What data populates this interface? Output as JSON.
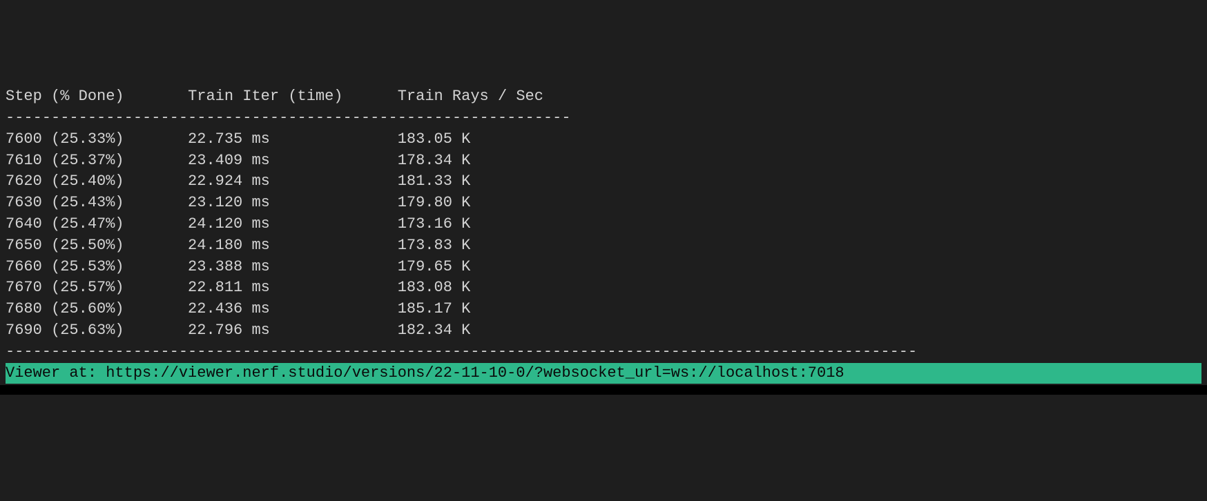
{
  "colors": {
    "background": "#1e1e1e",
    "foreground": "#d4d4d4",
    "highlight_bg": "#2eb88a",
    "highlight_fg": "#0a0a0a"
  },
  "headers": {
    "col1": "Step (% Done)",
    "col2": "Train Iter (time)",
    "col3": "Train Rays / Sec"
  },
  "divider_short": "--------------------------------------------------------------",
  "divider_long": "----------------------------------------------------------------------------------------------------",
  "rows": [
    {
      "step": "7600",
      "pct": "25.33%",
      "iter": "22.735 ms",
      "rays": "183.05 K"
    },
    {
      "step": "7610",
      "pct": "25.37%",
      "iter": "23.409 ms",
      "rays": "178.34 K"
    },
    {
      "step": "7620",
      "pct": "25.40%",
      "iter": "22.924 ms",
      "rays": "181.33 K"
    },
    {
      "step": "7630",
      "pct": "25.43%",
      "iter": "23.120 ms",
      "rays": "179.80 K"
    },
    {
      "step": "7640",
      "pct": "25.47%",
      "iter": "24.120 ms",
      "rays": "173.16 K"
    },
    {
      "step": "7650",
      "pct": "25.50%",
      "iter": "24.180 ms",
      "rays": "173.83 K"
    },
    {
      "step": "7660",
      "pct": "25.53%",
      "iter": "23.388 ms",
      "rays": "179.65 K"
    },
    {
      "step": "7670",
      "pct": "25.57%",
      "iter": "22.811 ms",
      "rays": "183.08 K"
    },
    {
      "step": "7680",
      "pct": "25.60%",
      "iter": "22.436 ms",
      "rays": "185.17 K"
    },
    {
      "step": "7690",
      "pct": "25.63%",
      "iter": "22.796 ms",
      "rays": "182.34 K"
    }
  ],
  "viewer": {
    "prefix": "Viewer at: ",
    "url": "https://viewer.nerf.studio/versions/22-11-10-0/?websocket_url=ws://localhost:7018"
  }
}
